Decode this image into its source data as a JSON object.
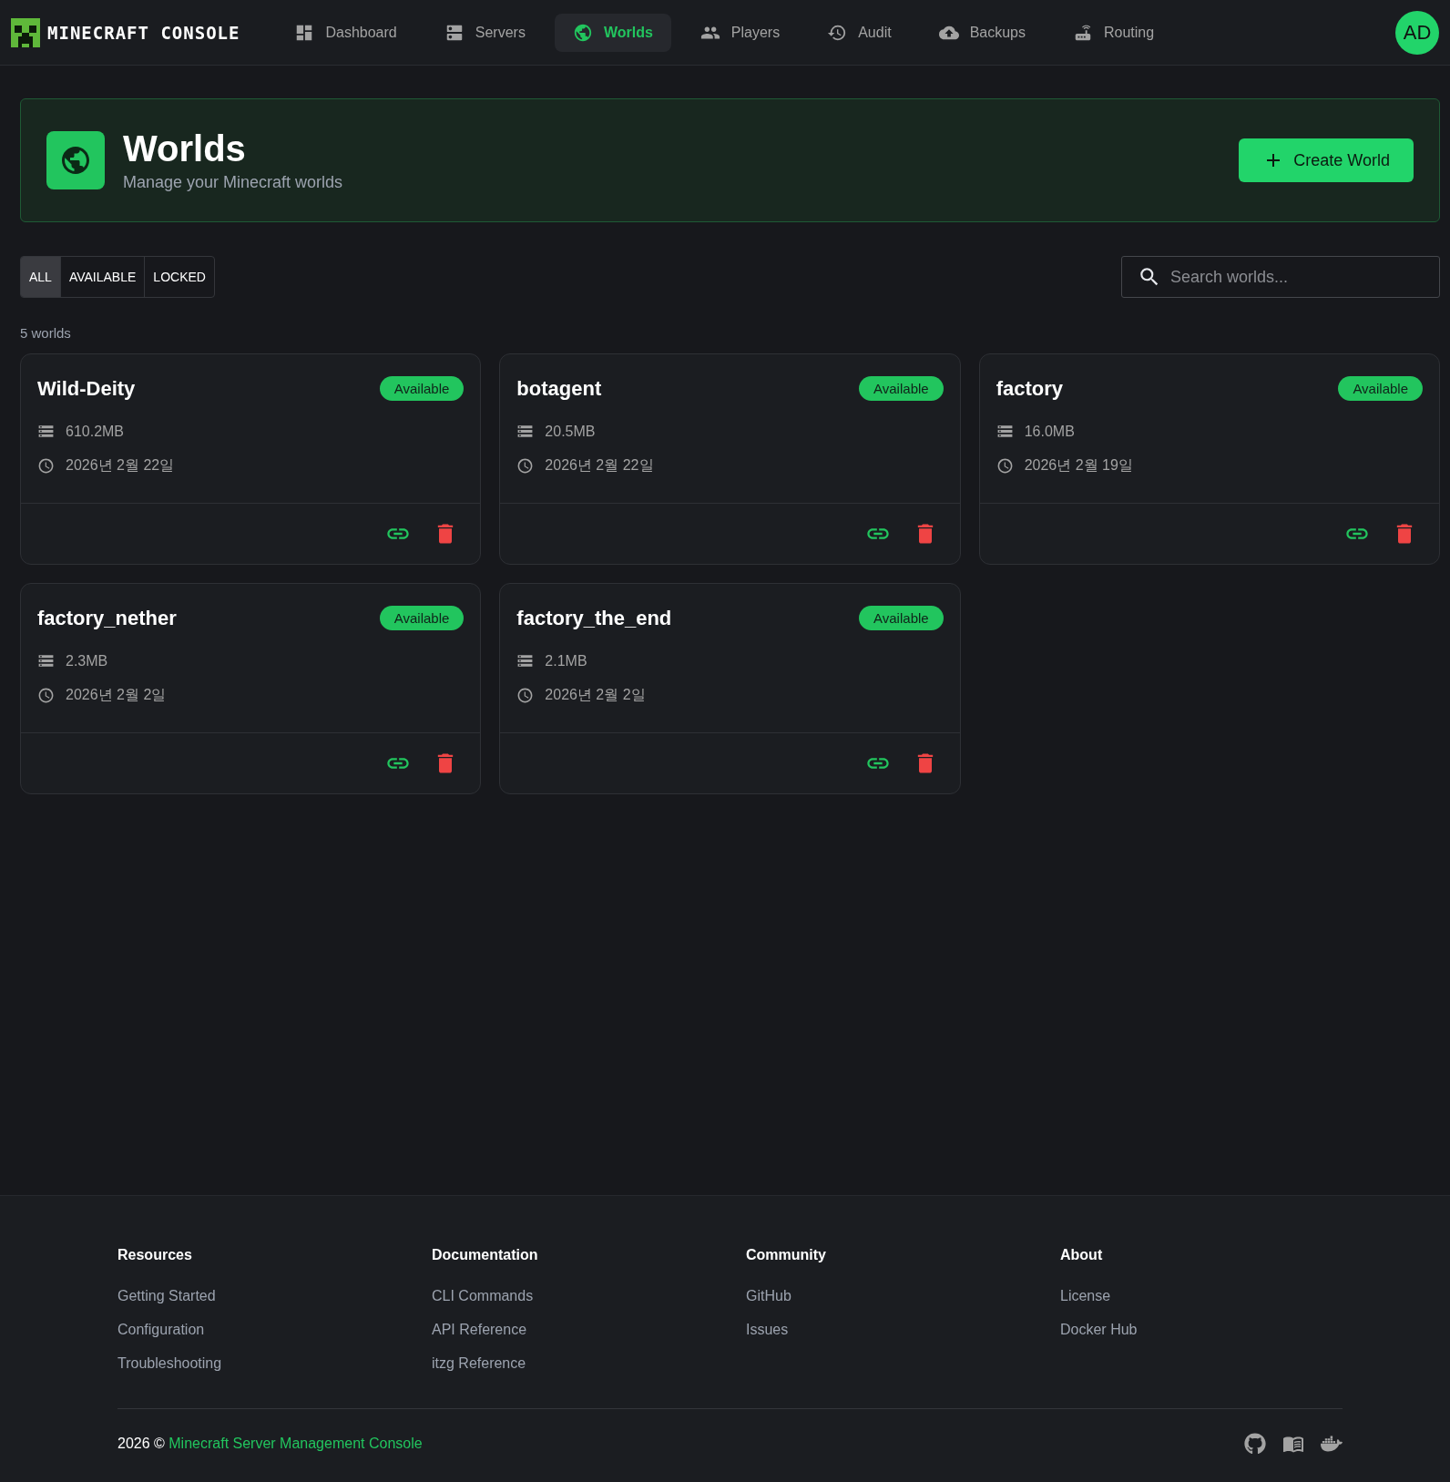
{
  "brand": {
    "name": "MINECRAFT CONSOLE"
  },
  "nav": [
    {
      "label": "Dashboard",
      "selected": false
    },
    {
      "label": "Servers",
      "selected": false
    },
    {
      "label": "Worlds",
      "selected": true
    },
    {
      "label": "Players",
      "selected": false
    },
    {
      "label": "Audit",
      "selected": false
    },
    {
      "label": "Backups",
      "selected": false
    },
    {
      "label": "Routing",
      "selected": false
    }
  ],
  "user": {
    "initials": "AD"
  },
  "hero": {
    "title": "Worlds",
    "subtitle": "Manage your Minecraft worlds",
    "action": "Create World"
  },
  "filters": [
    {
      "label": "ALL",
      "selected": true
    },
    {
      "label": "AVAILABLE",
      "selected": false
    },
    {
      "label": "LOCKED",
      "selected": false
    }
  ],
  "search": {
    "placeholder": "Search worlds..."
  },
  "count": "5 worlds",
  "worlds": [
    {
      "name": "Wild-Deity",
      "status": "Available",
      "kind": "available",
      "size": "610.2MB",
      "date": "2026년 2월 22일"
    },
    {
      "name": "botagent",
      "status": "Available",
      "kind": "available",
      "size": "20.5MB",
      "date": "2026년 2월 22일"
    },
    {
      "name": "factory",
      "status": "Available",
      "kind": "available",
      "size": "16.0MB",
      "date": "2026년 2월 19일"
    },
    {
      "name": "factory_nether",
      "status": "Available",
      "kind": "available",
      "size": "2.3MB",
      "date": "2026년 2월 2일"
    },
    {
      "name": "factory_the_end",
      "status": "Available",
      "kind": "available",
      "size": "2.1MB",
      "date": "2026년 2월 2일"
    }
  ],
  "footer": {
    "columns": [
      {
        "title": "Resources",
        "links": [
          "Getting Started",
          "Configuration",
          "Troubleshooting"
        ]
      },
      {
        "title": "Documentation",
        "links": [
          "CLI Commands",
          "API Reference",
          "itzg Reference"
        ]
      },
      {
        "title": "Community",
        "links": [
          "GitHub",
          "Issues"
        ]
      },
      {
        "title": "About",
        "links": [
          "License",
          "Docker Hub"
        ]
      }
    ],
    "copyright": "2026 ©",
    "product": "Minecraft Server Management Console"
  }
}
